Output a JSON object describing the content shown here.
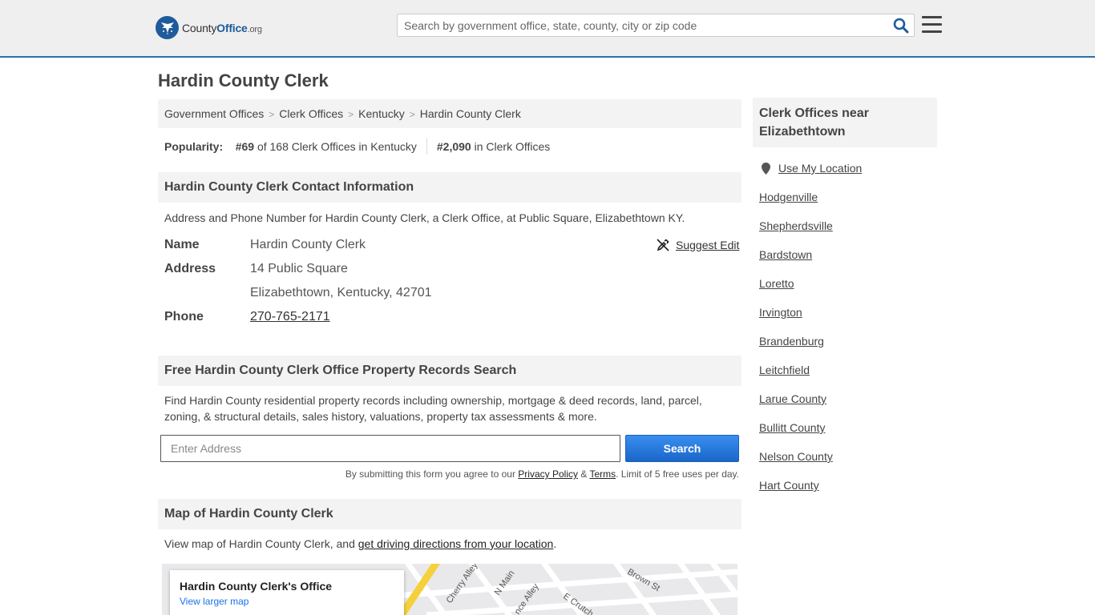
{
  "header": {
    "logo_brand": "County",
    "logo_brand_bold": "Office",
    "logo_tld": ".org",
    "search_placeholder": "Search by government office, state, county, city or zip code"
  },
  "page": {
    "title": "Hardin County Clerk"
  },
  "breadcrumb": [
    "Government Offices",
    "Clerk Offices",
    "Kentucky",
    "Hardin County Clerk"
  ],
  "popularity": {
    "label": "Popularity:",
    "rank_state": "#69",
    "rank_state_text": "of 168 Clerk Offices in Kentucky",
    "rank_national": "#2,090",
    "rank_national_text": "in Clerk Offices"
  },
  "contact": {
    "header": "Hardin County Clerk Contact Information",
    "description": "Address and Phone Number for Hardin County Clerk, a Clerk Office, at Public Square, Elizabethtown KY.",
    "name_label": "Name",
    "name_value": "Hardin County Clerk",
    "address_label": "Address",
    "address_line1": "14 Public Square",
    "address_line2": "Elizabethtown, Kentucky, 42701",
    "phone_label": "Phone",
    "phone_value": "270-765-2171",
    "suggest_edit": "Suggest Edit"
  },
  "property": {
    "header": "Free Hardin County Clerk Office Property Records Search",
    "description": "Find Hardin County residential property records including ownership, mortgage & deed records, land, parcel, zoning, & structural details, sales history, valuations, property tax assessments & more.",
    "address_placeholder": "Enter Address",
    "search_button": "Search",
    "terms_prefix": "By submitting this form you agree to our",
    "privacy_link": "Privacy Policy",
    "amp": "&",
    "terms_link": "Terms",
    "terms_suffix": ". Limit of 5 free uses per day."
  },
  "map": {
    "header": "Map of Hardin County Clerk",
    "description_prefix": "View map of Hardin County Clerk, and",
    "directions_link": "get driving directions from your location",
    "description_suffix": ".",
    "card_title": "Hardin County Clerk's Office",
    "card_link": "View larger map",
    "street_labels": [
      "Cherry Alley",
      "N Main",
      "Brown St",
      "E Crutch",
      "nce Alley"
    ]
  },
  "sidebar": {
    "header": "Clerk Offices near Elizabethtown",
    "use_location": "Use My Location",
    "links": [
      "Hodgenville",
      "Shepherdsville",
      "Bardstown",
      "Loretto",
      "Irvington",
      "Brandenburg",
      "Leitchfield",
      "Larue County",
      "Bullitt County",
      "Nelson County",
      "Hart County"
    ]
  },
  "colors": {
    "brand_blue": "#1e5b9b",
    "button_blue": "#1a66c9",
    "header_bg": "#efefef"
  }
}
